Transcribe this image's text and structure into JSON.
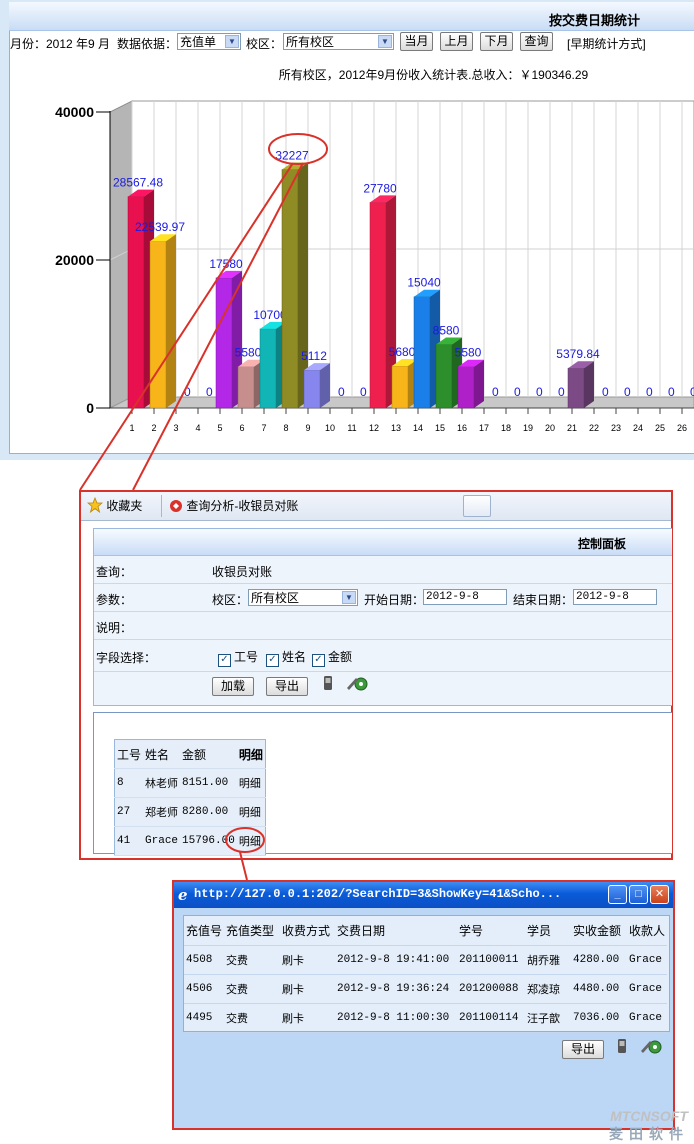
{
  "top": {
    "title": "按交费日期统计",
    "month_label": "月份：2012 年9 月",
    "basis_label": "数据依据：",
    "basis_value": "充值单",
    "campus_label": "校区：",
    "campus_value": "所有校区",
    "buttons": [
      "当月",
      "上月",
      "下月",
      "查询"
    ],
    "early_link": "[早期统计方式]",
    "caption": "所有校区，2012年9月份收入统计表.总收入：￥190346.29"
  },
  "chart_data": {
    "type": "bar",
    "categories": [
      "1",
      "2",
      "3",
      "4",
      "5",
      "6",
      "7",
      "8",
      "9",
      "10",
      "11",
      "12",
      "13",
      "14",
      "15",
      "16",
      "17",
      "18",
      "19",
      "20",
      "21",
      "22",
      "23",
      "24",
      "25",
      "26"
    ],
    "values": [
      28567.48,
      22539.97,
      0,
      0,
      17580,
      5580,
      10700,
      32227,
      5112,
      0,
      0,
      27780,
      5680,
      15040,
      8580,
      5580,
      0,
      0,
      0,
      0,
      5379.84,
      0,
      0,
      0,
      0,
      0
    ],
    "value_labels": [
      "28567.48",
      "22539.97",
      "0",
      "0",
      "17580",
      "5580",
      "10700",
      "32227",
      "5112",
      "0",
      "0",
      "27780",
      "5680",
      "15040",
      "8580",
      "5580",
      "0",
      "0",
      "0",
      "0",
      "5379.84",
      "0",
      "0",
      "0",
      "0",
      "0"
    ],
    "bar_colors": [
      "#e8104f",
      "#f7b51a",
      "#cccccc",
      "#cccccc",
      "#b327e6",
      "#c78e8e",
      "#12b5b5",
      "#8f8b25",
      "#8686ee",
      "#cccccc",
      "#cccccc",
      "#f0204e",
      "#f7b51a",
      "#1a7fe8",
      "#2c8f2c",
      "#b020c8",
      "#cccccc",
      "#cccccc",
      "#cccccc",
      "#cccccc",
      "#7c4b86",
      "#cccccc",
      "#cccccc",
      "#cccccc",
      "#cccccc",
      "#cccccc"
    ],
    "y_ticks": [
      "0",
      "20000",
      "40000"
    ],
    "ylim": [
      0,
      40000
    ],
    "grid": true,
    "legend": "none"
  },
  "browser": {
    "tabs": [
      "收藏夹",
      "查询分析-收银员对账"
    ],
    "panel_title": "控制面板",
    "rows": {
      "query_label": "查询：",
      "query_value": "收银员对账",
      "params_label": "参数：",
      "campus_label": "校区：",
      "campus_value": "所有校区",
      "start_label": "开始日期：",
      "start_value": "2012-9-8",
      "end_label": "结束日期：",
      "end_value": "2012-9-8",
      "desc_label": "说明：",
      "fields_label": "字段选择：",
      "fields": [
        "工号",
        "姓名",
        "金额"
      ]
    },
    "buttons": [
      "加载",
      "导出"
    ],
    "table": {
      "headers": [
        "工号",
        "姓名",
        "金额",
        "明细"
      ],
      "rows": [
        [
          "8",
          "林老师",
          "8151.00",
          "明细"
        ],
        [
          "27",
          "郑老师",
          "8280.00",
          "明细"
        ],
        [
          "41",
          "Grace",
          "15796.00",
          "明细"
        ]
      ]
    }
  },
  "popup": {
    "title": "http://127.0.0.1:202/?SearchID=3&ShowKey=41&Scho...",
    "headers": [
      "充值号",
      "充值类型",
      "收费方式",
      "交费日期",
      "学号",
      "学员",
      "实收金额",
      "收款人"
    ],
    "rows": [
      [
        "4508",
        "交费",
        "刷卡",
        "2012-9-8 19:41:00",
        "201100011",
        "胡乔雅",
        "4280.00",
        "Grace"
      ],
      [
        "4506",
        "交费",
        "刷卡",
        "2012-9-8 19:36:24",
        "201200088",
        "郑凌琼",
        "4480.00",
        "Grace"
      ],
      [
        "4495",
        "交费",
        "刷卡",
        "2012-9-8 11:00:30",
        "201100114",
        "汪子歆",
        "7036.00",
        "Grace"
      ]
    ],
    "export_button": "导出"
  },
  "watermark": {
    "brand": "MTCNSOFT",
    "brand_cn": "麦田软件"
  }
}
